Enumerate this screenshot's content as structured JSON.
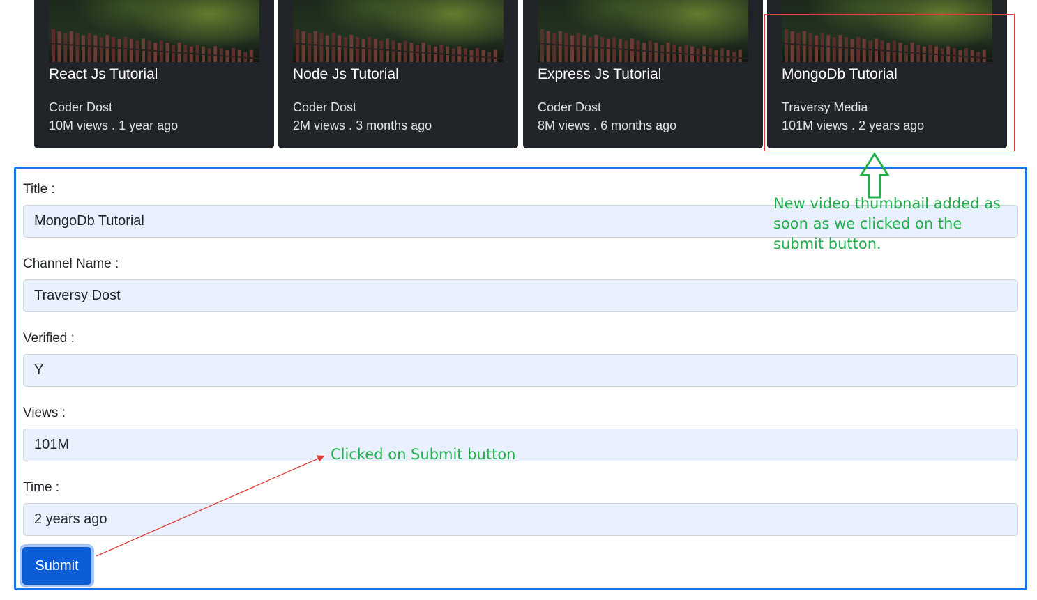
{
  "cards": [
    {
      "title": "React Js Tutorial",
      "channel": "Coder Dost",
      "views": "10M views",
      "separator": ".",
      "time": "1 year ago"
    },
    {
      "title": "Node Js Tutorial",
      "channel": "Coder Dost",
      "views": "2M views",
      "separator": ".",
      "time": "3 months ago"
    },
    {
      "title": "Express Js Tutorial",
      "channel": "Coder Dost",
      "views": "8M views",
      "separator": ".",
      "time": "6 months ago"
    },
    {
      "title": "MongoDb Tutorial",
      "channel": "Traversy Media",
      "views": "101M views",
      "separator": ".",
      "time": "2 years ago"
    }
  ],
  "form": {
    "title_label": "Title :",
    "title_value": "MongoDb Tutorial",
    "channel_label": "Channel Name :",
    "channel_value": "Traversy Dost",
    "verified_label": "Verified :",
    "verified_value": "Y",
    "views_label": "Views :",
    "views_value": "101M",
    "time_label": "Time :",
    "time_value": "2 years ago",
    "submit_label": "Submit"
  },
  "annotations": {
    "thumbnail_note": "New video thumbnail added as soon as we clicked on the submit button.",
    "submit_note": "Clicked on Submit button",
    "note_color": "#21b04b",
    "arrow_color": "#e0403a",
    "highlight_color": "#e0403a"
  },
  "colors": {
    "card_bg": "#212529",
    "form_border": "#1a73e8",
    "input_bg": "#e8f0fe",
    "button_bg": "#0b5ed7"
  }
}
